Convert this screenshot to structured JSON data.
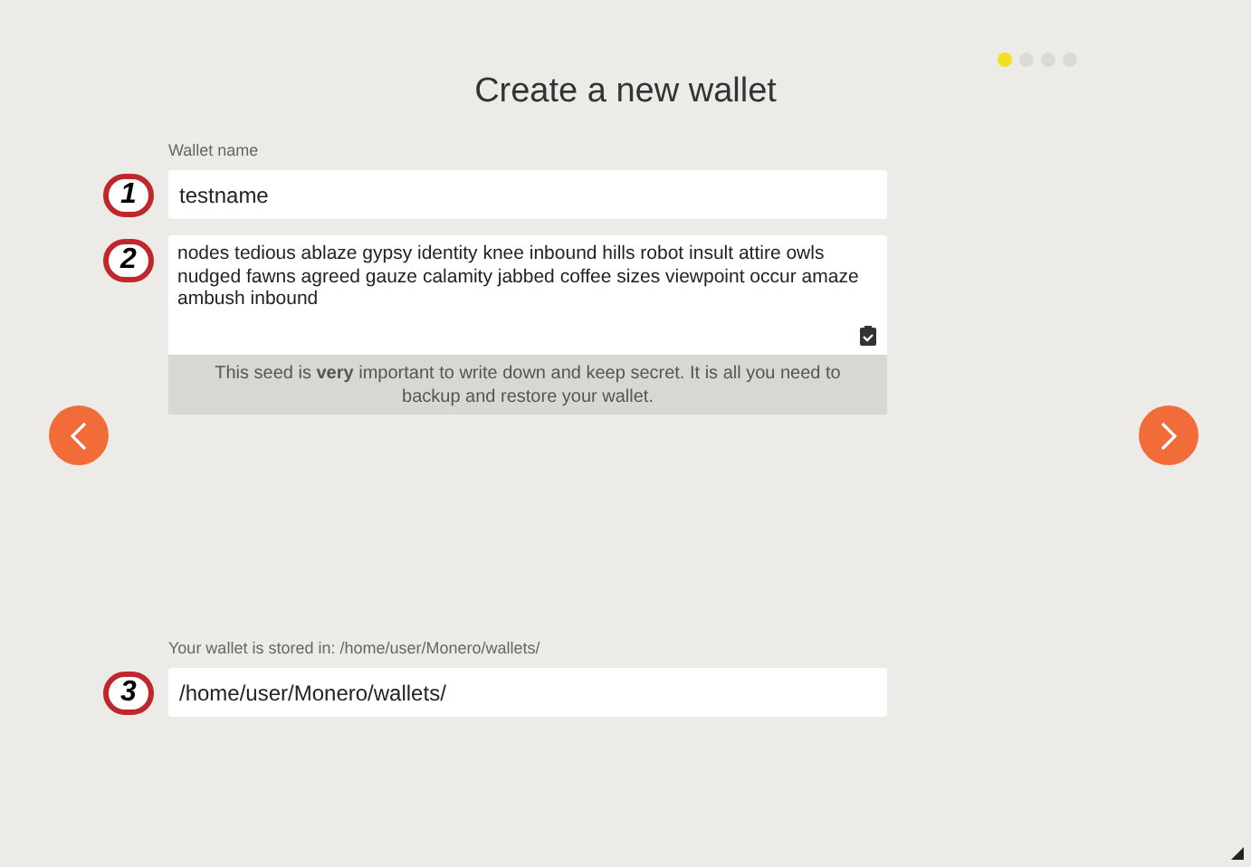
{
  "title": "Create a new wallet",
  "steps": [
    {
      "selected": true
    },
    {
      "selected": false
    },
    {
      "selected": false
    },
    {
      "selected": false
    }
  ],
  "wallet_name": {
    "label": "Wallet name",
    "marker": "1",
    "value": "testname"
  },
  "seed": {
    "marker": "2",
    "value": "nodes tedious ablaze gypsy identity knee inbound hills robot insult attire owls nudged fawns agreed gauze calamity jabbed coffee sizes viewpoint occur amaze ambush inbound",
    "note": "This seed is **very** important to write down and keep secret. It is all you need to backup and restore your wallet."
  },
  "location": {
    "label": "Your wallet is stored in: /home/user/Monero/wallets/",
    "marker": "3",
    "value": "/home/user/Monero/wallets/"
  }
}
